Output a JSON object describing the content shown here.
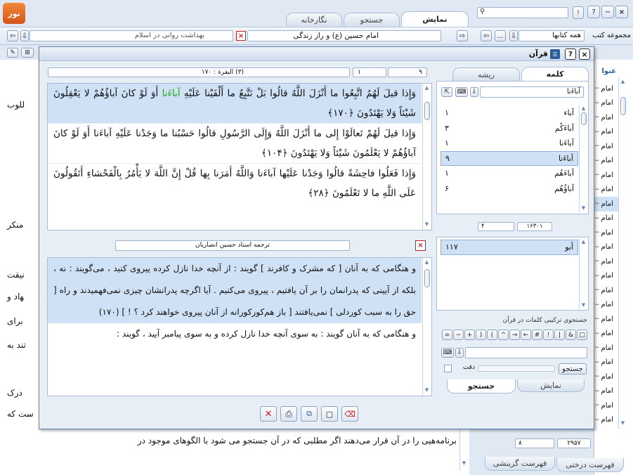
{
  "app": {
    "logo_text": "نور"
  },
  "top_tabs": [
    {
      "label": "نمایش"
    },
    {
      "label": "جستجو"
    },
    {
      "label": "نگارخانه"
    }
  ],
  "window_buttons": {
    "help": "?",
    "info": "!",
    "minimize": "−",
    "close": "×"
  },
  "address": {
    "doc_title": "امام حسین (ع) و راز زندگی",
    "secondary_title": "بهداشت روانی در اسلام",
    "collection_label": "مجموعه کتب",
    "collection_value": "همه کتابها",
    "dots": "..."
  },
  "background_doc": {
    "fragments": [
      "للوب",
      "منکر",
      "نیقت",
      "ﻬاد و",
      "برای",
      "تند به",
      "درک",
      "ست که"
    ],
    "bottom_line": "برنامه‌هیی را در آن قرار می‌دهند اگر مطلبی که در آن جستجو می شود با الگوهای موجود در"
  },
  "right_sidebar": {
    "header": "عنوا",
    "item_label": "امام",
    "item_count": 24,
    "page_total": "۲۹۵۷",
    "page_current": "۸",
    "tabs": [
      {
        "label": "فهرست درختی"
      },
      {
        "label": "فهرست گزینشی"
      }
    ]
  },
  "quran": {
    "title": "قرآن",
    "verse_nav": {
      "current": "۹",
      "total": "۱",
      "reference": "(۳) البقرة : ۱۷۰"
    },
    "verses": [
      {
        "pre": "وَإِذا قيلَ لَهُمُ اتَّبِعُوا ما أَنْزَلَ اللَّهُ قالُوا بَلْ نَتَّبِعُ ما أَلْفَيْنا عَلَيْهِ ",
        "hit": "آباءَنا",
        "post": " أَوَ لَوْ كانَ آباؤُهُمْ لا يَعْقِلُونَ شَيْئاً وَلا يَهْتَدُونَ ﴿۱۷۰﴾"
      },
      {
        "text": "وَإِذا قيلَ لَهُمْ تَعالَوْا إِلى ما أَنْزَلَ اللَّهُ وَإِلَى الرَّسُولِ قالُوا حَسْبُنا ما وَجَدْنا عَلَيْهِ آباءَنا أَوَ لَوْ كانَ آباؤُهُمْ لا يَعْلَمُونَ شَيْئاً وَلا يَهْتَدُونَ ﴿۱۰۴﴾"
      },
      {
        "text": "وَإِذا فَعَلُوا فاحِشَةً قالُوا وَجَدْنا عَلَيْها آباءَنا وَاللَّهُ أَمَرَنا بِها قُلْ إِنَّ اللَّهَ لا يَأْمُرُ بِالْفَحْشاءِ أَتَقُولُونَ عَلَى اللَّهِ ما لا تَعْلَمُونَ ﴿۲۸﴾"
      }
    ],
    "translator": "ترجمه استاد حسین انصاریان",
    "translation": "و هنگامی که به آنان [ که مشرک و کافرند ] گویند : از آنچه خدا نازل کرده پیروی کنید ، می‌گویند : نه ، بلکه از آیینی که پدرانمان را بر آن یافتیم ، پیروی می‌کنیم . آیا اگرچه پدرانشان چیزی نمی‌فهمیدند و راه [ حق را به سبب کوردلی ] نمی‌یافتند [ باز هم‌کورکورانه از آنان پیروی خواهند کرد ؟ ! ] (۱۷۰)",
    "translation_next": "و هنگامی که به آنان گویند : به سوی آنچه خدا نازل کرده و به سوی پیامبر آیید ، گویند :",
    "word_tabs": [
      {
        "label": "کلمه"
      },
      {
        "label": "ریشه"
      }
    ],
    "word_input": "آباءَنا",
    "words": [
      {
        "word": "آباء",
        "count": "۱"
      },
      {
        "word": "آباءَكُم",
        "count": "۳"
      },
      {
        "word": "آباءَنا",
        "count": "۱"
      },
      {
        "word": "آباءَنا",
        "count": "۹"
      },
      {
        "word": "آباءَهُم",
        "count": "۱"
      },
      {
        "word": "آباؤُهُم",
        "count": "۶"
      }
    ],
    "word_nav": {
      "total": "۱۶۳۰۱",
      "current": "۴"
    },
    "roots": [
      {
        "word": "أبو",
        "count": "۱۱۷"
      }
    ],
    "compound_label": "جستجوی ترکیبی کلمات در قرآن",
    "operators": [
      "□",
      "&",
      "|",
      "!",
      "#",
      "←",
      "→",
      "^",
      "(",
      ")",
      "+",
      "−",
      "="
    ],
    "search_button": "جستجو",
    "exact_label": "دقت",
    "bottom_tabs": [
      {
        "label": "نمایش"
      },
      {
        "label": "جستجو"
      }
    ]
  },
  "colors": {
    "highlight": "#cfe1f5",
    "hit": "#2e9b2e",
    "accent": "#2d5c97",
    "close_red": "#c42020"
  }
}
